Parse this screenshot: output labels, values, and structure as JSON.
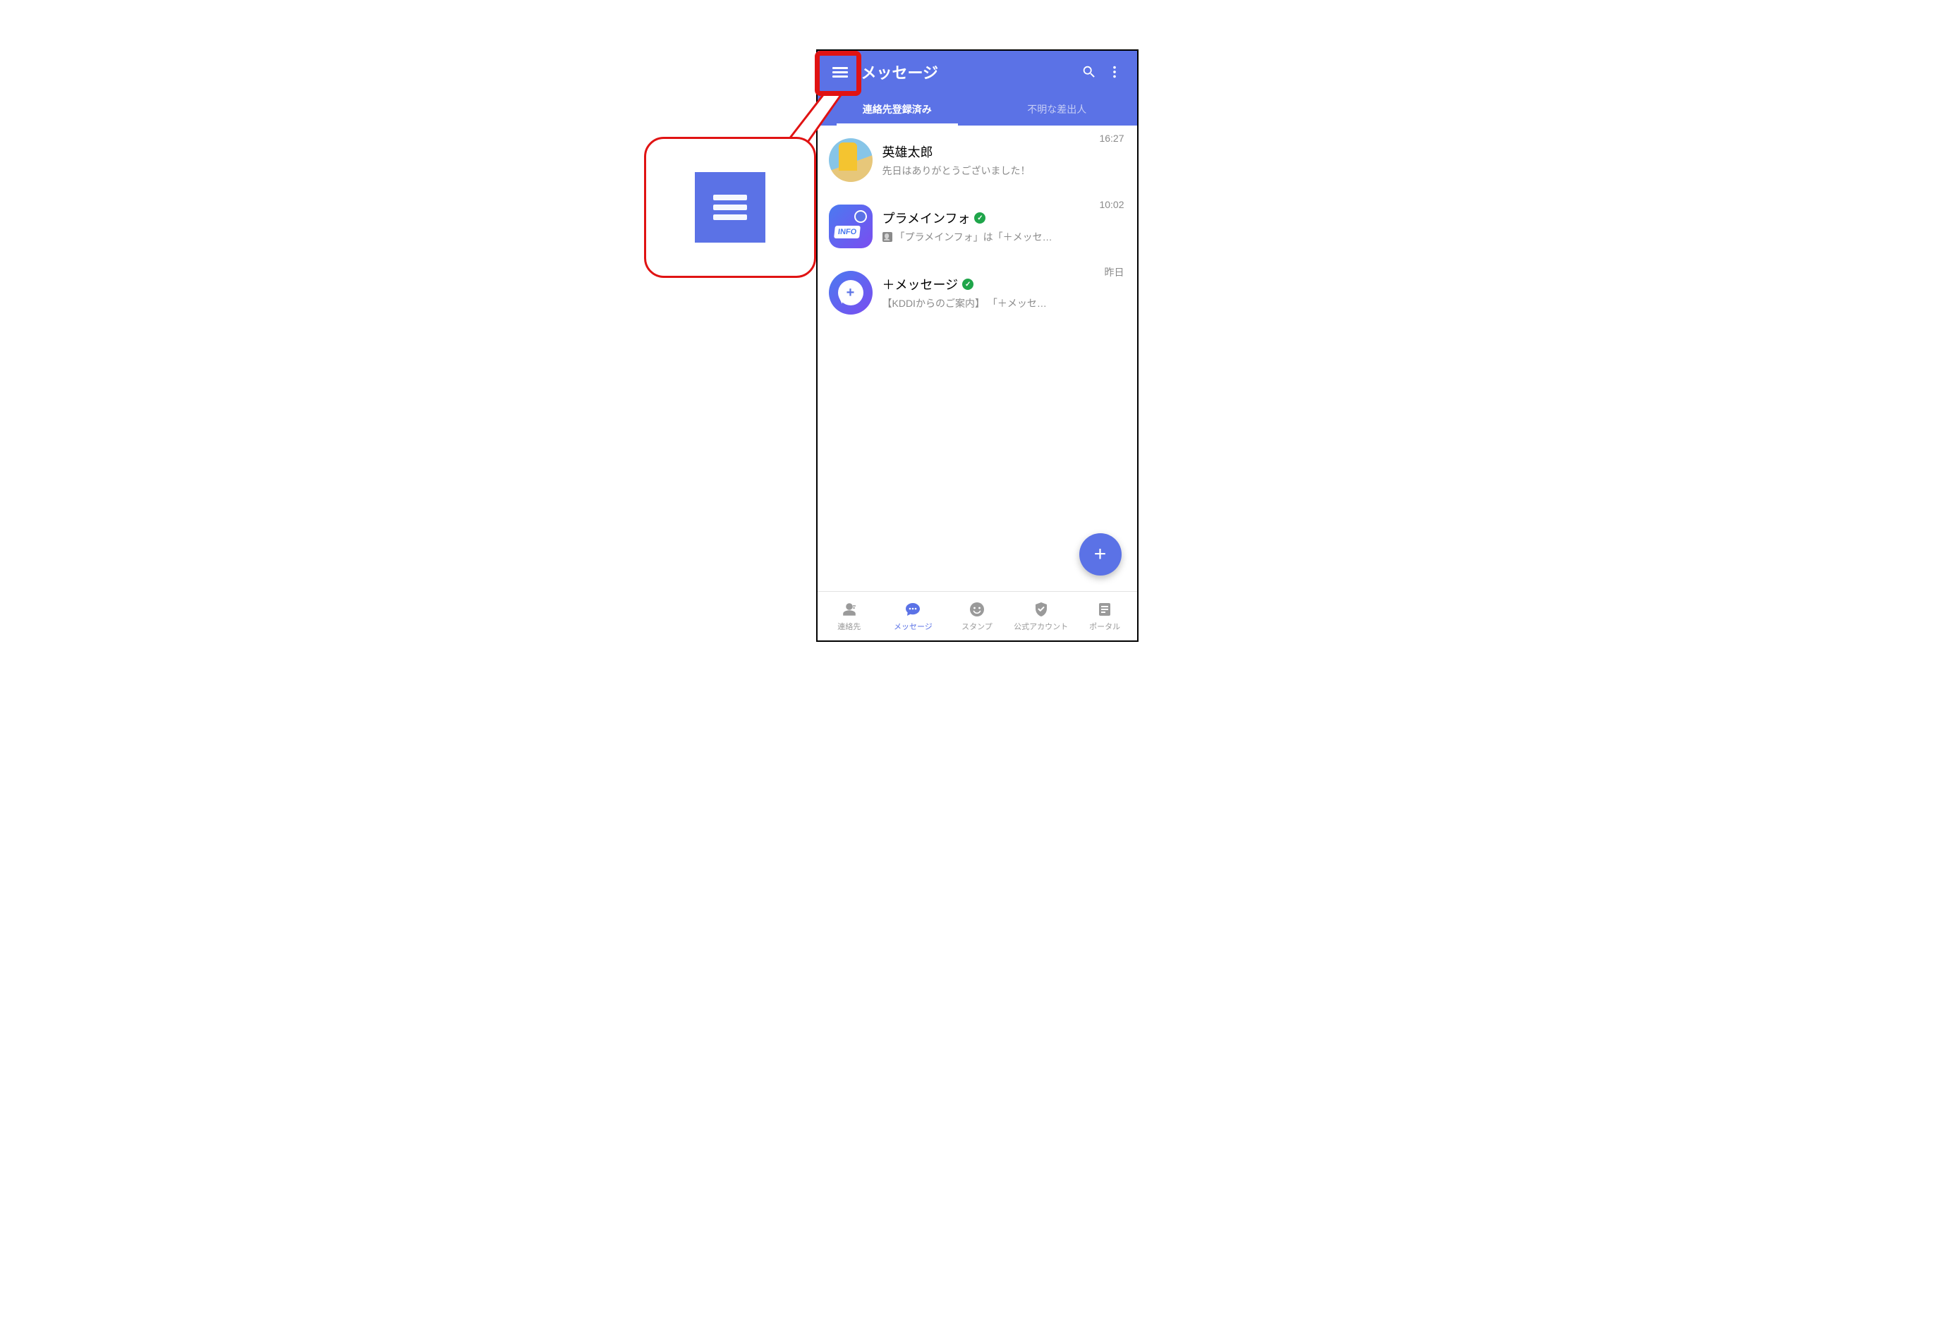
{
  "colors": {
    "primary": "#5b72e6",
    "highlight": "#e01313",
    "verified": "#1fa54a"
  },
  "appbar": {
    "title": "メッセージ"
  },
  "tabs": [
    {
      "label": "連絡先登録済み",
      "active": true
    },
    {
      "label": "不明な差出人",
      "active": false
    }
  ],
  "conversations": [
    {
      "name": "英雄太郎",
      "preview": "先日はありがとうございました！",
      "time": "16:27",
      "avatar": "photo",
      "verified": false,
      "has_contact_badge": false
    },
    {
      "name": "プラメインフォ",
      "preview": "「プラメインフォ」は「＋メッセ…",
      "time": "10:02",
      "avatar": "info",
      "avatar_label": "INFO",
      "verified": true,
      "has_contact_badge": true
    },
    {
      "name": "＋メッセージ",
      "preview": "【KDDIからのご案内】 「＋メッセ…",
      "time": "昨日",
      "avatar": "plus",
      "verified": true,
      "has_contact_badge": false
    }
  ],
  "fab": {
    "label": "+"
  },
  "bottomnav": [
    {
      "label": "連絡先",
      "icon": "contacts",
      "active": false
    },
    {
      "label": "メッセージ",
      "icon": "messages",
      "active": true
    },
    {
      "label": "スタンプ",
      "icon": "stamp",
      "active": false
    },
    {
      "label": "公式アカウント",
      "icon": "official",
      "active": false
    },
    {
      "label": "ポータル",
      "icon": "portal",
      "active": false
    }
  ],
  "callout": {
    "icon": "hamburger"
  }
}
